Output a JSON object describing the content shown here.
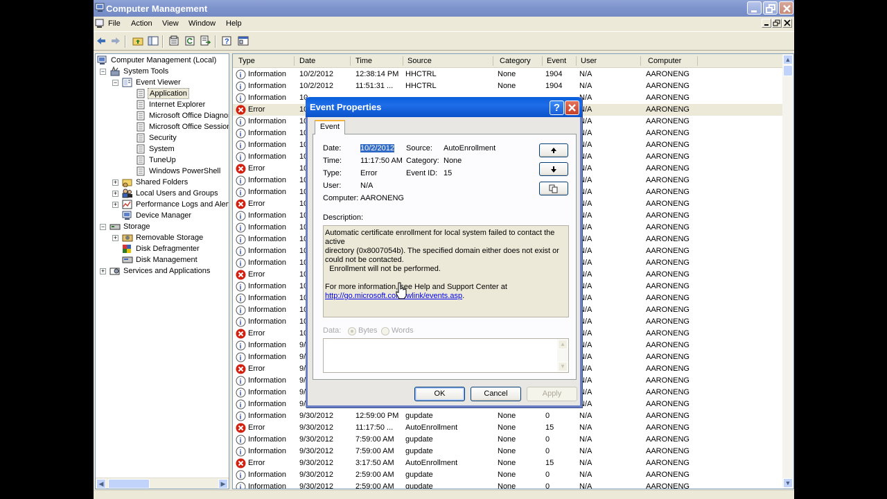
{
  "window": {
    "title": "Computer Management"
  },
  "menu": {
    "items": [
      "File",
      "Action",
      "View",
      "Window",
      "Help"
    ]
  },
  "toolbar": {
    "icons": [
      "back-icon",
      "forward-icon",
      "up-folder-icon",
      "show-hide-tree-icon",
      "properties-icon",
      "refresh-icon",
      "export-list-icon",
      "help-icon",
      "console-icon"
    ]
  },
  "tree": {
    "items": [
      {
        "label": "Computer Management (Local)",
        "icon": "computer-icon"
      },
      {
        "label": "System Tools",
        "icon": "tools-icon"
      },
      {
        "label": "Event Viewer",
        "icon": "event-viewer-icon"
      },
      {
        "label": "Application",
        "icon": "log-icon"
      },
      {
        "label": "Internet Explorer",
        "icon": "log-icon"
      },
      {
        "label": "Microsoft Office Diagnos",
        "icon": "log-icon"
      },
      {
        "label": "Microsoft Office Session",
        "icon": "log-icon"
      },
      {
        "label": "Security",
        "icon": "log-icon"
      },
      {
        "label": "System",
        "icon": "log-icon"
      },
      {
        "label": "TuneUp",
        "icon": "log-icon"
      },
      {
        "label": "Windows PowerShell",
        "icon": "log-icon"
      },
      {
        "label": "Shared Folders",
        "icon": "shared-folder-icon"
      },
      {
        "label": "Local Users and Groups",
        "icon": "users-icon"
      },
      {
        "label": "Performance Logs and Alerts",
        "icon": "performance-icon"
      },
      {
        "label": "Device Manager",
        "icon": "device-manager-icon"
      },
      {
        "label": "Storage",
        "icon": "storage-icon"
      },
      {
        "label": "Removable Storage",
        "icon": "removable-storage-icon"
      },
      {
        "label": "Disk Defragmenter",
        "icon": "defrag-icon"
      },
      {
        "label": "Disk Management",
        "icon": "disk-icon"
      },
      {
        "label": "Services and Applications",
        "icon": "services-icon"
      }
    ]
  },
  "list": {
    "columns": [
      "Type",
      "Date",
      "Time",
      "Source",
      "Category",
      "Event",
      "User",
      "Computer"
    ],
    "rows": [
      {
        "type": "Information",
        "date": "10/2/2012",
        "time": "12:38:14 PM",
        "source": "HHCTRL",
        "category": "None",
        "event": "1904",
        "user": "N/A",
        "computer": "AARONENG"
      },
      {
        "type": "Information",
        "date": "10/2/2012",
        "time": "11:51:31 ...",
        "source": "HHCTRL",
        "category": "None",
        "event": "1904",
        "user": "N/A",
        "computer": "AARONENG"
      },
      {
        "type": "Information",
        "date": "10",
        "time": "",
        "source": "",
        "category": "",
        "event": "",
        "user": "N/A",
        "computer": "AARONENG"
      },
      {
        "type": "Error",
        "date": "10",
        "time": "",
        "source": "",
        "category": "",
        "event": "",
        "user": "N/A",
        "computer": "AARONENG"
      },
      {
        "type": "Information",
        "date": "10",
        "time": "",
        "source": "",
        "category": "",
        "event": "",
        "user": "N/A",
        "computer": "AARONENG"
      },
      {
        "type": "Information",
        "date": "10",
        "time": "",
        "source": "",
        "category": "",
        "event": "",
        "user": "N/A",
        "computer": "AARONENG"
      },
      {
        "type": "Information",
        "date": "10",
        "time": "",
        "source": "",
        "category": "",
        "event": "",
        "user": "N/A",
        "computer": "AARONENG"
      },
      {
        "type": "Information",
        "date": "10",
        "time": "",
        "source": "",
        "category": "",
        "event": "",
        "user": "N/A",
        "computer": "AARONENG"
      },
      {
        "type": "Error",
        "date": "10",
        "time": "",
        "source": "",
        "category": "",
        "event": "",
        "user": "N/A",
        "computer": "AARONENG"
      },
      {
        "type": "Information",
        "date": "10",
        "time": "",
        "source": "",
        "category": "",
        "event": "",
        "user": "N/A",
        "computer": "AARONENG"
      },
      {
        "type": "Information",
        "date": "10",
        "time": "",
        "source": "",
        "category": "",
        "event": "",
        "user": "N/A",
        "computer": "AARONENG"
      },
      {
        "type": "Error",
        "date": "10",
        "time": "",
        "source": "",
        "category": "",
        "event": "",
        "user": "N/A",
        "computer": "AARONENG"
      },
      {
        "type": "Information",
        "date": "10",
        "time": "",
        "source": "",
        "category": "",
        "event": "",
        "user": "N/A",
        "computer": "AARONENG"
      },
      {
        "type": "Information",
        "date": "10",
        "time": "",
        "source": "",
        "category": "",
        "event": "",
        "user": "N/A",
        "computer": "AARONENG"
      },
      {
        "type": "Information",
        "date": "10",
        "time": "",
        "source": "",
        "category": "",
        "event": "",
        "user": "N/A",
        "computer": "AARONENG"
      },
      {
        "type": "Information",
        "date": "10",
        "time": "",
        "source": "",
        "category": "",
        "event": "",
        "user": "N/A",
        "computer": "AARONENG"
      },
      {
        "type": "Information",
        "date": "10",
        "time": "",
        "source": "",
        "category": "",
        "event": "",
        "user": "N/A",
        "computer": "AARONENG"
      },
      {
        "type": "Error",
        "date": "10",
        "time": "",
        "source": "",
        "category": "",
        "event": "",
        "user": "N/A",
        "computer": "AARONENG"
      },
      {
        "type": "Information",
        "date": "10",
        "time": "",
        "source": "",
        "category": "",
        "event": "",
        "user": "N/A",
        "computer": "AARONENG"
      },
      {
        "type": "Information",
        "date": "10",
        "time": "",
        "source": "",
        "category": "",
        "event": "",
        "user": "N/A",
        "computer": "AARONENG"
      },
      {
        "type": "Information",
        "date": "10",
        "time": "",
        "source": "",
        "category": "",
        "event": "",
        "user": "N/A",
        "computer": "AARONENG"
      },
      {
        "type": "Information",
        "date": "10",
        "time": "",
        "source": "",
        "category": "",
        "event": "",
        "user": "N/A",
        "computer": "AARONENG"
      },
      {
        "type": "Error",
        "date": "10",
        "time": "",
        "source": "",
        "category": "",
        "event": "",
        "user": "N/A",
        "computer": "AARONENG"
      },
      {
        "type": "Information",
        "date": "9/",
        "time": "",
        "source": "",
        "category": "",
        "event": "",
        "user": "N/A",
        "computer": "AARONENG"
      },
      {
        "type": "Information",
        "date": "9/",
        "time": "",
        "source": "",
        "category": "",
        "event": "",
        "user": "N/A",
        "computer": "AARONENG"
      },
      {
        "type": "Error",
        "date": "9/",
        "time": "",
        "source": "",
        "category": "",
        "event": "",
        "user": "N/A",
        "computer": "AARONENG"
      },
      {
        "type": "Information",
        "date": "9/",
        "time": "",
        "source": "",
        "category": "",
        "event": "",
        "user": "N/A",
        "computer": "AARONENG"
      },
      {
        "type": "Information",
        "date": "9/",
        "time": "",
        "source": "",
        "category": "",
        "event": "",
        "user": "N/A",
        "computer": "AARONENG"
      },
      {
        "type": "Information",
        "date": "9/",
        "time": "",
        "source": "",
        "category": "",
        "event": "",
        "user": "N/A",
        "computer": "AARONENG"
      },
      {
        "type": "Information",
        "date": "9/30/2012",
        "time": "12:59:00 PM",
        "source": "gupdate",
        "category": "None",
        "event": "0",
        "user": "N/A",
        "computer": "AARONENG"
      },
      {
        "type": "Error",
        "date": "9/30/2012",
        "time": "11:17:50 ...",
        "source": "AutoEnrollment",
        "category": "None",
        "event": "15",
        "user": "N/A",
        "computer": "AARONENG"
      },
      {
        "type": "Information",
        "date": "9/30/2012",
        "time": "7:59:00 AM",
        "source": "gupdate",
        "category": "None",
        "event": "0",
        "user": "N/A",
        "computer": "AARONENG"
      },
      {
        "type": "Information",
        "date": "9/30/2012",
        "time": "7:59:00 AM",
        "source": "gupdate",
        "category": "None",
        "event": "0",
        "user": "N/A",
        "computer": "AARONENG"
      },
      {
        "type": "Error",
        "date": "9/30/2012",
        "time": "3:17:50 AM",
        "source": "AutoEnrollment",
        "category": "None",
        "event": "15",
        "user": "N/A",
        "computer": "AARONENG"
      },
      {
        "type": "Information",
        "date": "9/30/2012",
        "time": "2:59:00 AM",
        "source": "gupdate",
        "category": "None",
        "event": "0",
        "user": "N/A",
        "computer": "AARONENG"
      },
      {
        "type": "Information",
        "date": "9/30/2012",
        "time": "2:59:00 AM",
        "source": "gupdate",
        "category": "None",
        "event": "0",
        "user": "N/A",
        "computer": "AARONENG"
      }
    ]
  },
  "dialog": {
    "title": "Event Properties",
    "help_glyph": "?",
    "tab": "Event",
    "date_label": "Date:",
    "date_value": "10/2/2012",
    "source_label": "Source:",
    "source_value": "AutoEnrollment",
    "time_label": "Time:",
    "time_value": "11:17:50 AM",
    "category_label": "Category:",
    "category_value": "None",
    "type_label": "Type:",
    "type_value": "Error",
    "eventid_label": "Event ID:",
    "eventid_value": "15",
    "user_label": "User:",
    "user_value": "N/A",
    "computer_label": "Computer:",
    "computer_value": "AARONENG",
    "description_label": "Description:",
    "description_lines": [
      "Automatic certificate enrollment for local system failed to contact the active",
      "directory (0x8007054b).  The specified domain either does not exist or",
      "could not be contacted.",
      "  Enrollment will not be performed.",
      "",
      "For more information, see Help and Support Center at"
    ],
    "description_link": "http://go.microsoft.com/fwlink/events.asp",
    "description_link_suffix": ".",
    "data_label": "Data:",
    "bytes_label": "Bytes",
    "words_label": "Words",
    "ok_label": "OK",
    "cancel_label": "Cancel",
    "apply_label": "Apply"
  },
  "colors": {
    "title_bar": "#7d93cc",
    "dialog_title": "#0a5fdb",
    "error_red": "#d3210f",
    "info_blue": "#2a4f99",
    "selection": "#316ac5",
    "link": "#0000ee"
  }
}
